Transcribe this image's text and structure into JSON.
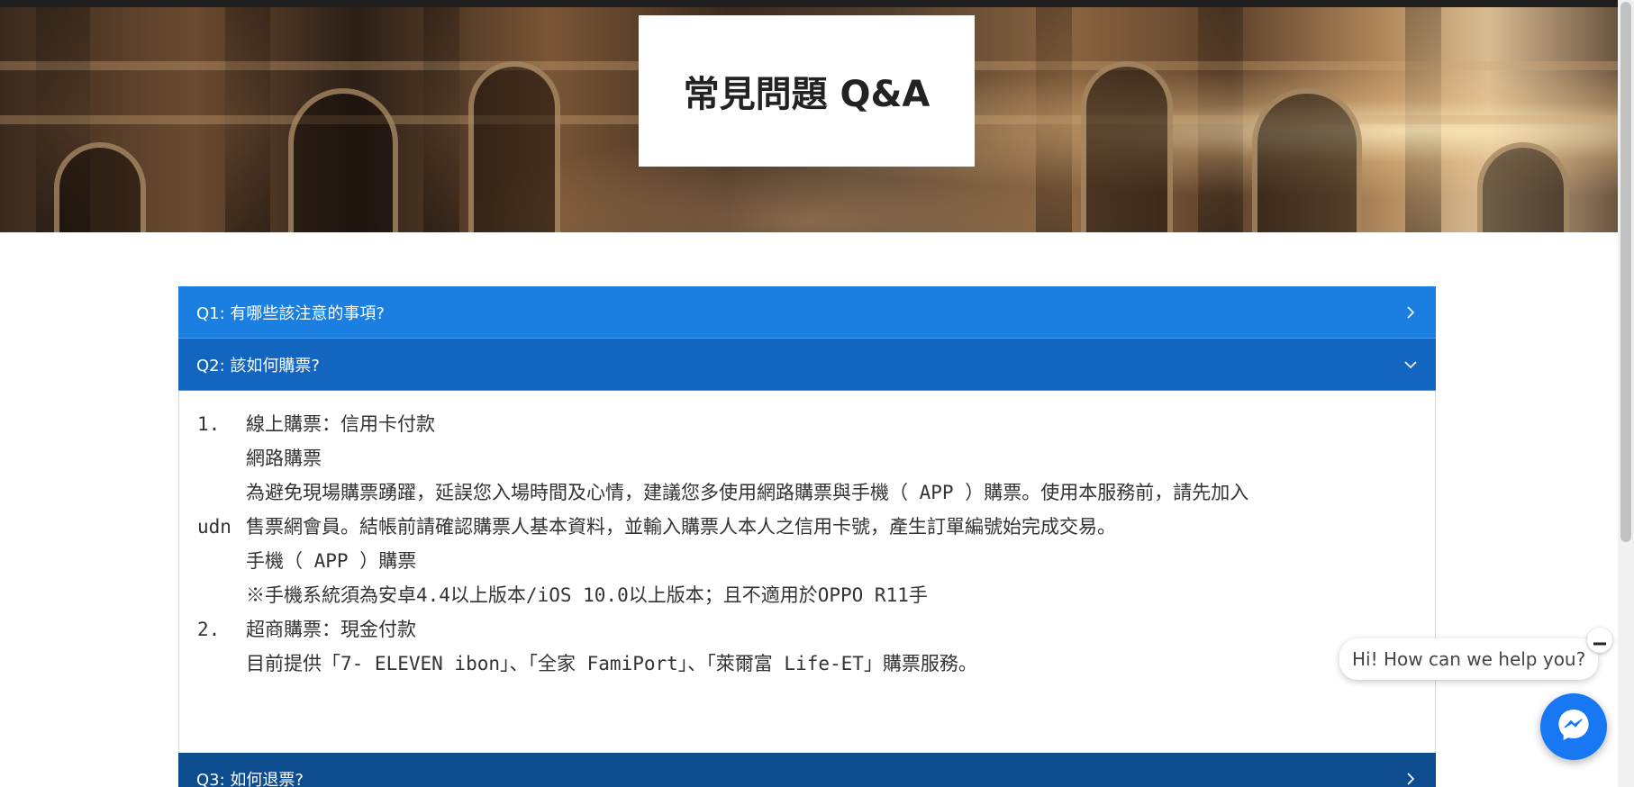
{
  "hero": {
    "title": "常見問題 Q&A"
  },
  "faq": [
    {
      "question": "Q1: 有哪些該注意的事項?",
      "expanded": false
    },
    {
      "question": "Q2: 該如何購票?",
      "expanded": true,
      "answer": {
        "items": [
          {
            "number": "1.",
            "title": "線上購票：信用卡付款",
            "lines": [
              "網路購票",
              "為避免現場購票踴躍，延誤您入場時間及心情，建議您多使用網路購票與手機（ APP ）購票。使用本服務前，請先加入",
              "udn",
              "售票網會員。結帳前請確認購票人基本資料，並輸入購票人本人之信用卡號，產生訂單編號始完成交易。",
              "手機（ APP ）購票",
              "※手機系統須為安卓4.4以上版本/iOS 10.0以上版本；且不適用於OPPO R11手"
            ]
          },
          {
            "number": "2.",
            "title": "超商購票：現金付款",
            "lines": [
              "目前提供「7- ELEVEN ibon」、「全家 FamiPort」、「萊爾富 Life-ET」購票服務。"
            ]
          }
        ]
      }
    },
    {
      "question": "Q3: 如何退票?",
      "expanded": false
    }
  ],
  "chat": {
    "greeting": "Hi! How can we help you?",
    "close_icon": "minus-icon",
    "launcher_icon": "messenger-icon"
  },
  "colors": {
    "q1": "#1a7fe0",
    "q2": "#1366bf",
    "q3": "#0c4c8f",
    "messenger": "#1877f2"
  }
}
